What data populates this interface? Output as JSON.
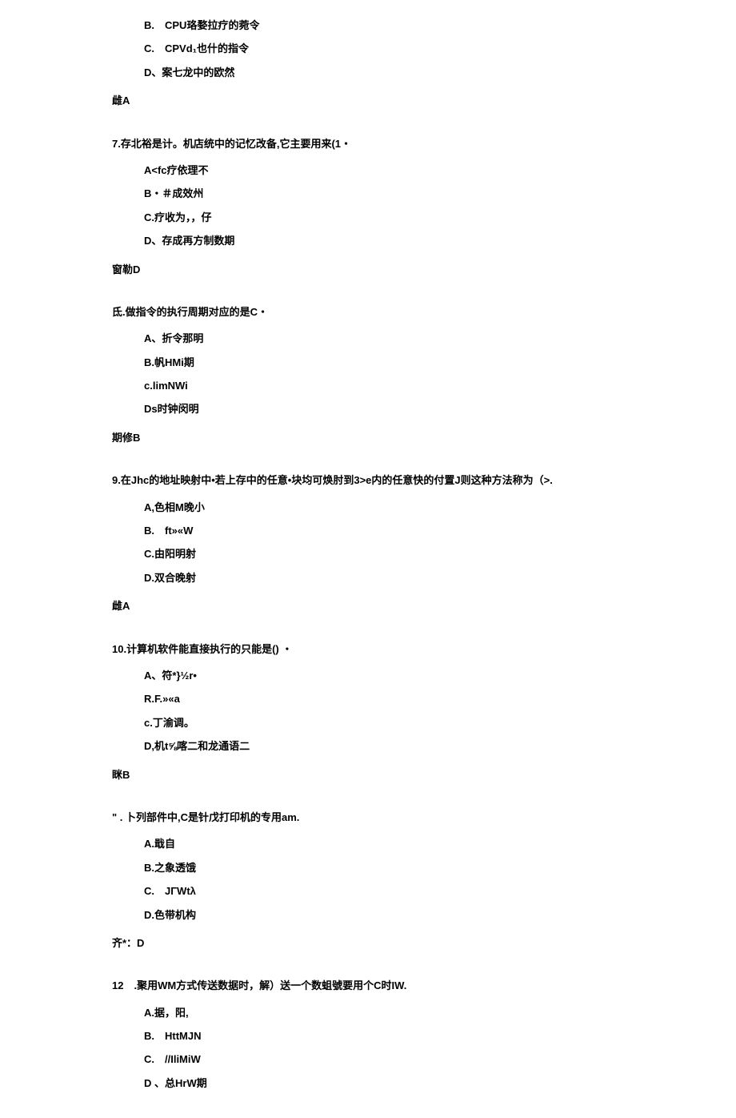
{
  "q6": {
    "options": {
      "b": "B.　CPU珞婺拉疗的菀令",
      "c": "C.　CPVd₁也什的指令",
      "d": "D、案七龙中的欧然"
    },
    "answer": "雌A"
  },
  "q7": {
    "text": "7.存北裕是计。机店统中的记忆改备,它主要用来(1・",
    "options": {
      "a": "A<fc疗依理不",
      "b": "B・＃成效州",
      "c": "C.疗收为，，仔",
      "d": "D、存成再方制数期"
    },
    "answer": "窗勒D"
  },
  "q8": {
    "text": "氐.做指令的执行周期对应的是C・",
    "options": {
      "a": "A、折令那明",
      "b": "B.帆HMi期",
      "c": "c.limNWi",
      "d": "Ds时钟闵明"
    },
    "answer": "期修B"
  },
  "q9": {
    "text": "9.在Jhc的地址映射中•若上存中的任意•块均可焕肘到3>e内的任意快的付置J则这种方法称为（>.",
    "options": {
      "a": "A,色相M晚小",
      "b": "B.　ft»«W",
      "c": "C.由阳明射",
      "d": "D.双合晚射"
    },
    "answer": "雌A"
  },
  "q10": {
    "text": "10.计算机软件能直接执行的只能是() ・",
    "options": {
      "a": "A、符*}½r•",
      "b": "R.F.»«a",
      "c": "c.丁渝调。",
      "d": "D,机t⅝喀二和龙通语二"
    },
    "answer": "眯B"
  },
  "q11": {
    "text": "\" . 卜列部件中,C是针戊打印机的专用am.",
    "options": {
      "a": "A.戢自",
      "b": "B.之象透饿",
      "c": "C.　JΓWtλ",
      "d": "D.色带机构"
    },
    "answer": "齐*：D"
  },
  "q12": {
    "text": "12　.聚用WM方式传送数据时，解）送一个数蛆號要用个C时IW.",
    "options": {
      "a": "A.据，阳,",
      "b": "B.　HttMJN",
      "c": "C.　//IliMiW",
      "d": "D 、总HrW期"
    }
  }
}
